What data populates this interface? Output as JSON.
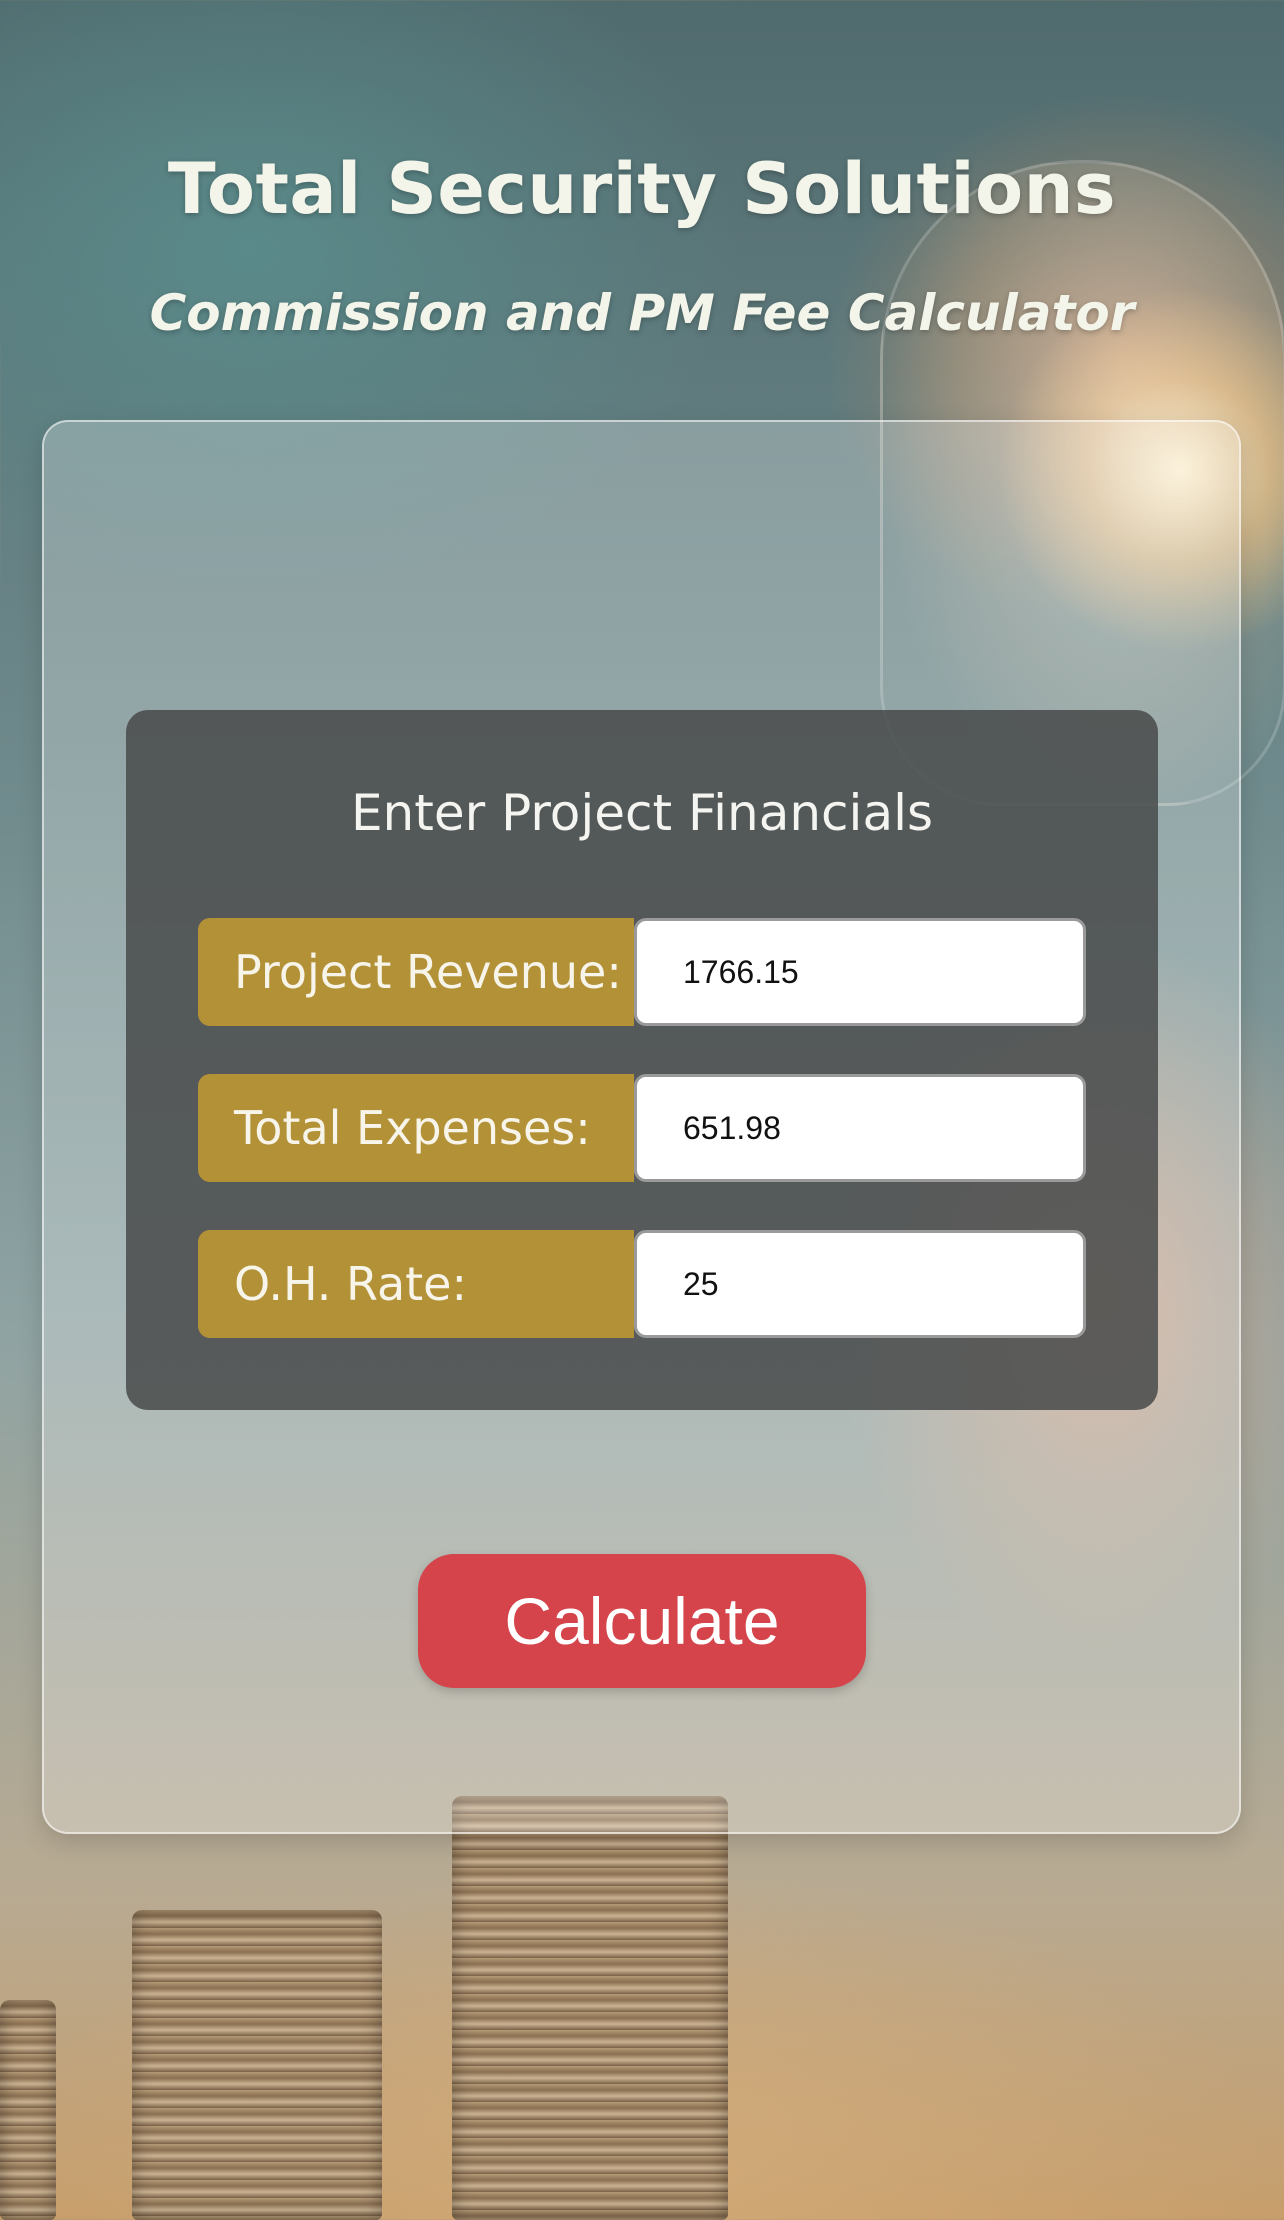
{
  "header": {
    "title": "Total Security Solutions",
    "subtitle": "Commission and PM Fee Calculator"
  },
  "form": {
    "heading": "Enter Project Financials",
    "fields": [
      {
        "label": "Project Revenue:",
        "value": "1766.15"
      },
      {
        "label": "Total Expenses:",
        "value": "651.98"
      },
      {
        "label": "O.H. Rate:",
        "value": "25"
      }
    ],
    "submit_label": "Calculate"
  },
  "colors": {
    "label_bg": "#b39137",
    "button_bg": "#d5444b",
    "panel_bg": "#484a4a"
  }
}
